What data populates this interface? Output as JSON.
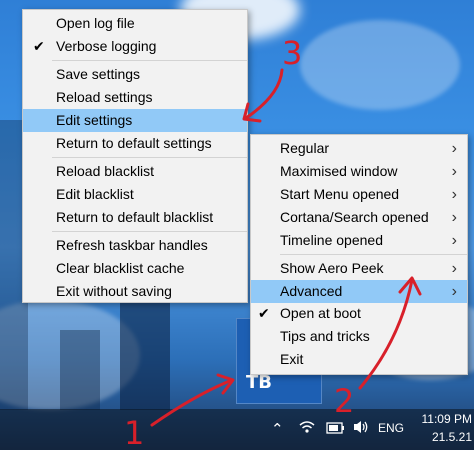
{
  "main_menu": {
    "items": [
      {
        "label": "Open log file",
        "checked": false,
        "highlight": false
      },
      {
        "label": "Verbose logging",
        "checked": true,
        "highlight": false
      },
      {
        "label": "Save settings",
        "checked": false,
        "highlight": false
      },
      {
        "label": "Reload settings",
        "checked": false,
        "highlight": false
      },
      {
        "label": "Edit settings",
        "checked": false,
        "highlight": true
      },
      {
        "label": "Return to default settings",
        "checked": false,
        "highlight": false
      },
      {
        "label": "Reload blacklist",
        "checked": false,
        "highlight": false
      },
      {
        "label": "Edit blacklist",
        "checked": false,
        "highlight": false
      },
      {
        "label": "Return to default blacklist",
        "checked": false,
        "highlight": false
      },
      {
        "label": "Refresh taskbar handles",
        "checked": false,
        "highlight": false
      },
      {
        "label": "Clear blacklist cache",
        "checked": false,
        "highlight": false
      },
      {
        "label": "Exit without saving",
        "checked": false,
        "highlight": false
      }
    ]
  },
  "sub_menu": {
    "items": [
      {
        "label": "Regular",
        "arrow": true
      },
      {
        "label": "Maximised window",
        "arrow": true
      },
      {
        "label": "Start Menu opened",
        "arrow": true
      },
      {
        "label": "Cortana/Search opened",
        "arrow": true
      },
      {
        "label": "Timeline opened",
        "arrow": true
      },
      {
        "label": "Show Aero Peek",
        "arrow": true
      },
      {
        "label": "Advanced",
        "arrow": true,
        "highlight": true
      },
      {
        "label": "Open at boot",
        "checked": true
      },
      {
        "label": "Tips and tricks"
      },
      {
        "label": "Exit"
      }
    ]
  },
  "tray": {
    "app_icon_text": "TB",
    "language": "ENG",
    "time": "11:09 PM",
    "date": "21.5.21"
  },
  "annotations": {
    "numbers": [
      "1",
      "2",
      "3"
    ],
    "color": "#d8202a"
  },
  "colors": {
    "menu_bg": "#f2f2f2",
    "highlight": "#91c9f7"
  }
}
